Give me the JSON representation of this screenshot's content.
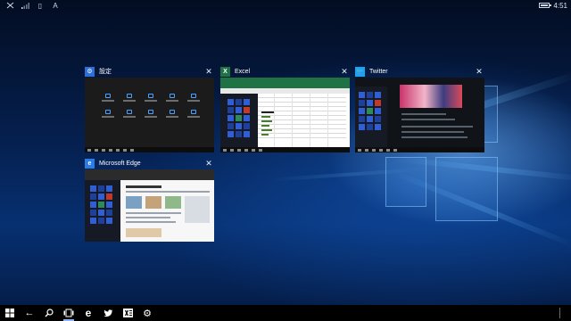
{
  "status_bar": {
    "icons": [
      "no-signal-icon",
      "cellular-bars-icon",
      "sim-icon",
      "font-size-icon"
    ],
    "sim_glyph": "▯",
    "font_glyph": "A",
    "time": "4:51",
    "battery_level": 0.75
  },
  "task_view": {
    "cards": [
      {
        "title": "設定",
        "icon": "gear-icon",
        "icon_color": "#2d6fd6",
        "icon_glyph": "⚙"
      },
      {
        "title": "Excel",
        "icon": "excel-icon",
        "icon_color": "#1f7244",
        "icon_glyph": "X"
      },
      {
        "title": "Twitter",
        "icon": "twitter-bird-icon",
        "icon_color": "#1da1f2",
        "icon_glyph": "🐦"
      },
      {
        "title": "Microsoft Edge",
        "icon": "edge-icon",
        "icon_color": "#2d7be4",
        "icon_glyph": "e"
      }
    ],
    "close_glyph": "✕"
  },
  "taskbar": {
    "buttons": [
      {
        "name": "start-button",
        "icon": "windows-logo-icon",
        "glyph": "⊞"
      },
      {
        "name": "back-button",
        "icon": "back-arrow-icon",
        "glyph": "←"
      },
      {
        "name": "search-button",
        "icon": "search-icon",
        "glyph": "⚲"
      },
      {
        "name": "task-view-button",
        "icon": "task-view-icon",
        "glyph": "▭"
      },
      {
        "name": "edge-taskbar-button",
        "icon": "edge-icon",
        "glyph": "e"
      },
      {
        "name": "twitter-taskbar-button",
        "icon": "twitter-bird-icon",
        "glyph": "🐦"
      },
      {
        "name": "excel-taskbar-button",
        "icon": "excel-icon",
        "glyph": "X"
      },
      {
        "name": "settings-taskbar-button",
        "icon": "gear-icon",
        "glyph": "⚙"
      }
    ],
    "show_desktop": "show-desktop-button"
  },
  "colors": {
    "accent": "#2d6fd6",
    "taskbar_bg": "#000000",
    "wallpaper_dark": "#041a42",
    "wallpaper_light": "#4aa3ff"
  }
}
